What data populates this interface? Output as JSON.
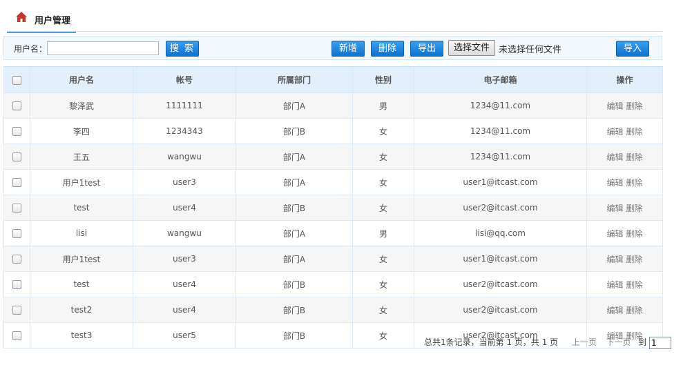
{
  "header": {
    "icon": "home-icon",
    "title": "用户管理",
    "accent_color": "#4aa0d9",
    "icon_color": "#c0392b"
  },
  "toolbar": {
    "search_label": "用户名：",
    "search_value": "",
    "search_button": "搜 索",
    "add_button": "新增",
    "delete_button": "删除",
    "export_button": "导出",
    "choose_file_button": "选择文件",
    "file_status": "未选择任何文件",
    "import_button": "导入",
    "button_color": "#1a84dd"
  },
  "table": {
    "columns": [
      "用户名",
      "帐号",
      "所属部门",
      "性别",
      "电子邮箱",
      "操作"
    ],
    "edit_label": "编辑",
    "delete_label": "删除",
    "rows": [
      {
        "username": "黎泽武",
        "account": "1111111",
        "department": "部门A",
        "gender": "男",
        "email": "1234@11.com"
      },
      {
        "username": "李四",
        "account": "1234343",
        "department": "部门B",
        "gender": "女",
        "email": "1234@11.com"
      },
      {
        "username": "王五",
        "account": "wangwu",
        "department": "部门A",
        "gender": "女",
        "email": "1234@11.com"
      },
      {
        "username": "用户1test",
        "account": "user3",
        "department": "部门A",
        "gender": "女",
        "email": "user1@itcast.com"
      },
      {
        "username": "test",
        "account": "user4",
        "department": "部门B",
        "gender": "女",
        "email": "user2@itcast.com"
      },
      {
        "username": "lisi",
        "account": "wangwu",
        "department": "部门A",
        "gender": "男",
        "email": "lisi@qq.com"
      },
      {
        "username": "用户1test",
        "account": "user3",
        "department": "部门A",
        "gender": "女",
        "email": "user1@itcast.com"
      },
      {
        "username": "test",
        "account": "user4",
        "department": "部门B",
        "gender": "女",
        "email": "user2@itcast.com"
      },
      {
        "username": "test2",
        "account": "user4",
        "department": "部门B",
        "gender": "女",
        "email": "user2@itcast.com"
      },
      {
        "username": "test3",
        "account": "user5",
        "department": "部门B",
        "gender": "女",
        "email": "user2@itcast.com"
      }
    ]
  },
  "pager": {
    "summary": "总共1条记录，当前第 1 页，共 1 页",
    "prev": "上一页",
    "next": "下一页",
    "goto_label": "到",
    "page_value": "1"
  }
}
